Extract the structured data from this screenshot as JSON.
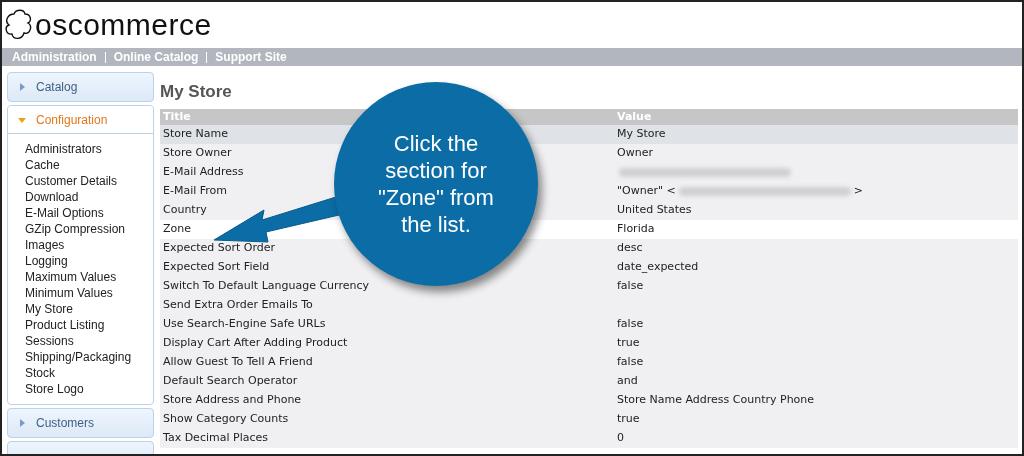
{
  "logo": {
    "text": "oscommerce"
  },
  "nav": [
    "Administration",
    "Online Catalog",
    "Support Site"
  ],
  "sidebar": {
    "sections": [
      {
        "label": "Catalog",
        "expanded": false
      },
      {
        "label": "Configuration",
        "expanded": true,
        "items": [
          "Administrators",
          "Cache",
          "Customer Details",
          "Download",
          "E-Mail Options",
          "GZip Compression",
          "Images",
          "Logging",
          "Maximum Values",
          "Minimum Values",
          "My Store",
          "Product Listing",
          "Sessions",
          "Shipping/Packaging",
          "Stock",
          "Store Logo"
        ]
      },
      {
        "label": "Customers",
        "expanded": false
      }
    ]
  },
  "heading": "My Store",
  "table": {
    "columns": [
      "Title",
      "Value"
    ],
    "rows": [
      {
        "title": "Store Name",
        "value": "My Store",
        "hovered": false,
        "selected": true
      },
      {
        "title": "Store Owner",
        "value": "Owner",
        "hovered": false,
        "selected": false
      },
      {
        "title": "E-Mail Address",
        "redacted": true,
        "hovered": false,
        "selected": false
      },
      {
        "title": "E-Mail From",
        "value": "\"Owner\" <",
        "redacted": true,
        "value_after": ">",
        "hovered": false,
        "selected": false
      },
      {
        "title": "Country",
        "value": "United States",
        "hovered": false,
        "selected": false
      },
      {
        "title": "Zone",
        "value": "Florida",
        "hovered": true,
        "selected": false
      },
      {
        "title": "Expected Sort Order",
        "value": "desc",
        "hovered": false,
        "selected": false
      },
      {
        "title": "Expected Sort Field",
        "value": "date_expected",
        "hovered": false,
        "selected": false
      },
      {
        "title": "Switch To Default Language Currency",
        "value": "false",
        "hovered": false,
        "selected": false
      },
      {
        "title": "Send Extra Order Emails To",
        "hovered": false,
        "selected": false
      },
      {
        "title": "Use Search-Engine Safe URLs",
        "value": "false",
        "hovered": false,
        "selected": false
      },
      {
        "title": "Display Cart After Adding Product",
        "value": "true",
        "hovered": false,
        "selected": false
      },
      {
        "title": "Allow Guest To Tell A Friend",
        "value": "false",
        "hovered": false,
        "selected": false
      },
      {
        "title": "Default Search Operator",
        "value": "and",
        "hovered": false,
        "selected": false
      },
      {
        "title": "Store Address and Phone",
        "value": "Store Name Address Country Phone",
        "hovered": false,
        "selected": false
      },
      {
        "title": "Show Category Counts",
        "value": "true",
        "hovered": false,
        "selected": false
      },
      {
        "title": "Tax Decimal Places",
        "value": "0",
        "hovered": false,
        "selected": false
      }
    ]
  },
  "callout": {
    "text": "Click the section for \"Zone\" from the list."
  }
}
